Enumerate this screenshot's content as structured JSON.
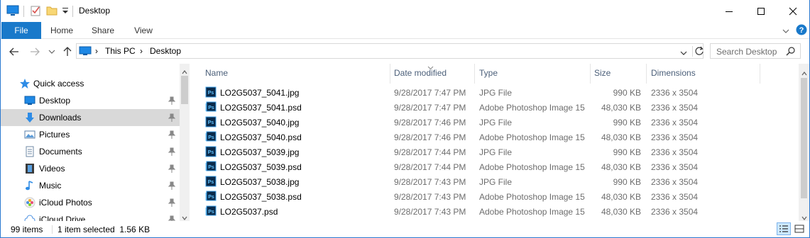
{
  "window": {
    "title": "Desktop",
    "accent": "#1979ca"
  },
  "ribbon": {
    "tabs": [
      {
        "label": "File"
      },
      {
        "label": "Home"
      },
      {
        "label": "Share"
      },
      {
        "label": "View"
      }
    ]
  },
  "address": {
    "crumbs": [
      "This PC",
      "Desktop"
    ],
    "search_placeholder": "Search Desktop"
  },
  "navpane": {
    "quick_access": "Quick access",
    "items": [
      {
        "label": "Desktop",
        "icon": "desktop-icon",
        "pinned": true,
        "selected": false
      },
      {
        "label": "Downloads",
        "icon": "downloads-icon",
        "pinned": true,
        "selected": true
      },
      {
        "label": "Pictures",
        "icon": "pictures-icon",
        "pinned": true,
        "selected": false
      },
      {
        "label": "Documents",
        "icon": "documents-icon",
        "pinned": true,
        "selected": false
      },
      {
        "label": "Videos",
        "icon": "videos-icon",
        "pinned": true,
        "selected": false
      },
      {
        "label": "Music",
        "icon": "music-icon",
        "pinned": true,
        "selected": false
      },
      {
        "label": "iCloud Photos",
        "icon": "icloud-photos-icon",
        "pinned": true,
        "selected": false
      },
      {
        "label": "iCloud Drive",
        "icon": "icloud-drive-icon",
        "pinned": true,
        "selected": false
      }
    ]
  },
  "filelist": {
    "columns": {
      "name": "Name",
      "date": "Date modified",
      "type": "Type",
      "size": "Size",
      "dimensions": "Dimensions"
    },
    "rows": [
      {
        "name": "LO2G5037_5041.jpg",
        "date": "9/28/2017 7:47 PM",
        "type": "JPG File",
        "size": "990 KB",
        "dim": "2336 x 3504",
        "kind": "jpg"
      },
      {
        "name": "LO2G5037_5041.psd",
        "date": "9/28/2017 7:47 PM",
        "type": "Adobe Photoshop Image 15",
        "size": "48,030 KB",
        "dim": "2336 x 3504",
        "kind": "psd"
      },
      {
        "name": "LO2G5037_5040.jpg",
        "date": "9/28/2017 7:46 PM",
        "type": "JPG File",
        "size": "990 KB",
        "dim": "2336 x 3504",
        "kind": "jpg"
      },
      {
        "name": "LO2G5037_5040.psd",
        "date": "9/28/2017 7:46 PM",
        "type": "Adobe Photoshop Image 15",
        "size": "48,030 KB",
        "dim": "2336 x 3504",
        "kind": "psd"
      },
      {
        "name": "LO2G5037_5039.jpg",
        "date": "9/28/2017 7:44 PM",
        "type": "JPG File",
        "size": "990 KB",
        "dim": "2336 x 3504",
        "kind": "jpg"
      },
      {
        "name": "LO2G5037_5039.psd",
        "date": "9/28/2017 7:44 PM",
        "type": "Adobe Photoshop Image 15",
        "size": "48,030 KB",
        "dim": "2336 x 3504",
        "kind": "psd"
      },
      {
        "name": "LO2G5037_5038.jpg",
        "date": "9/28/2017 7:43 PM",
        "type": "JPG File",
        "size": "990 KB",
        "dim": "2336 x 3504",
        "kind": "jpg"
      },
      {
        "name": "LO2G5037_5038.psd",
        "date": "9/28/2017 7:43 PM",
        "type": "Adobe Photoshop Image 15",
        "size": "48,030 KB",
        "dim": "2336 x 3504",
        "kind": "psd"
      },
      {
        "name": "LO2G5037.psd",
        "date": "9/28/2017 7:43 PM",
        "type": "Adobe Photoshop Image 15",
        "size": "48,030 KB",
        "dim": "2336 x 3504",
        "kind": "psd"
      }
    ]
  },
  "status": {
    "item_count": "99 items",
    "selection": "1 item selected  1.56 KB"
  }
}
